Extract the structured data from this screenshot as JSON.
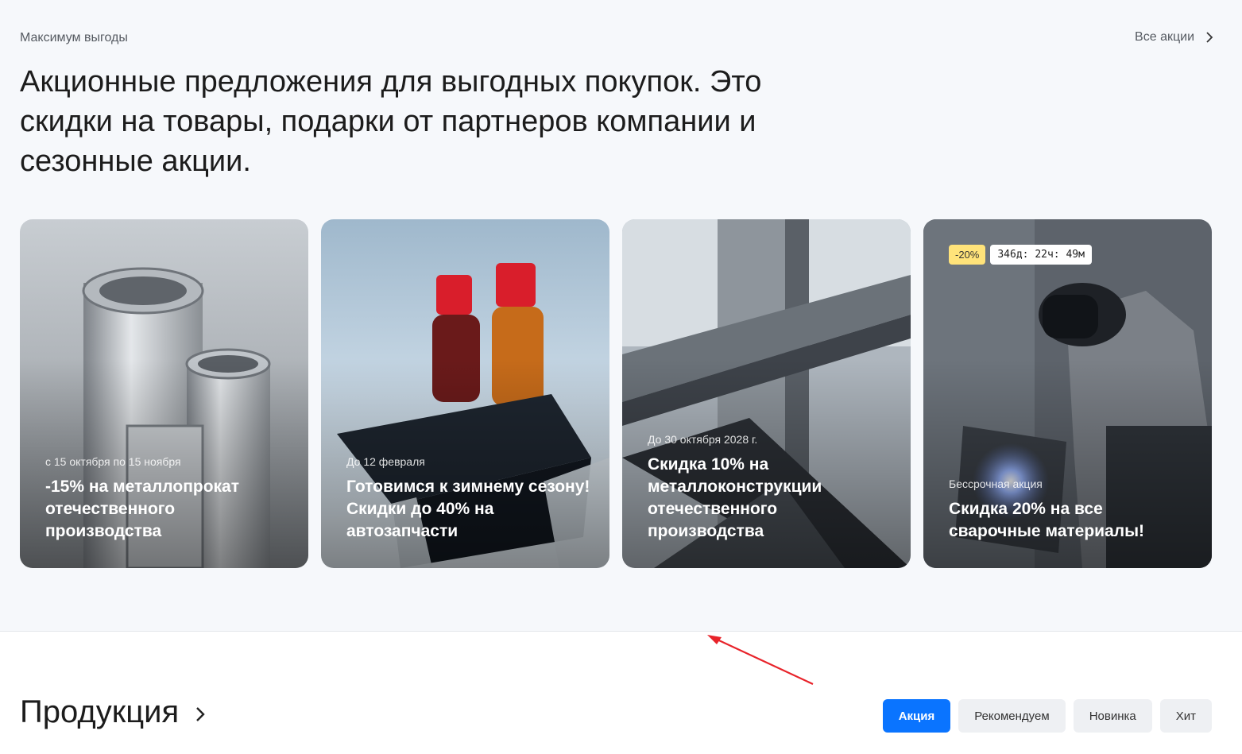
{
  "promo": {
    "eyebrow": "Максимум выгоды",
    "all_link": "Все акции",
    "headline": "Акционные предложения для выгодных покупок. Это скидки на товары, подарки от партнеров компании и сезонные акции.",
    "cards": [
      {
        "date": "с 15 октября по 15 ноября",
        "title": "-15% на металлопрокат отечественного производства",
        "image": "metal-pipes"
      },
      {
        "date": "До 12 февраля",
        "title": "Готовимся к зимнему сезону! Скидки до 40% на автозапчасти",
        "image": "car-battery-on-ice"
      },
      {
        "date": "До 30 октября 2028 г.",
        "title": "Скидка 10% на металлоконструкции отечественного производства",
        "image": "steel-beams"
      },
      {
        "date": "Бессрочная акция",
        "title": "Скидка 20% на все сварочные материалы!",
        "image": "welder",
        "discount_badge": "-20%",
        "timer": "346д: 22ч: 49м"
      }
    ]
  },
  "products": {
    "title": "Продукция",
    "filters": [
      "Акция",
      "Рекомендуем",
      "Новинка",
      "Хит"
    ],
    "active_filter": "Акция"
  },
  "colors": {
    "accent": "#0a74ff",
    "promo_bg": "#f6f8fb",
    "badge_yellow": "#ffe37a",
    "annotation_red": "#e8232a"
  }
}
